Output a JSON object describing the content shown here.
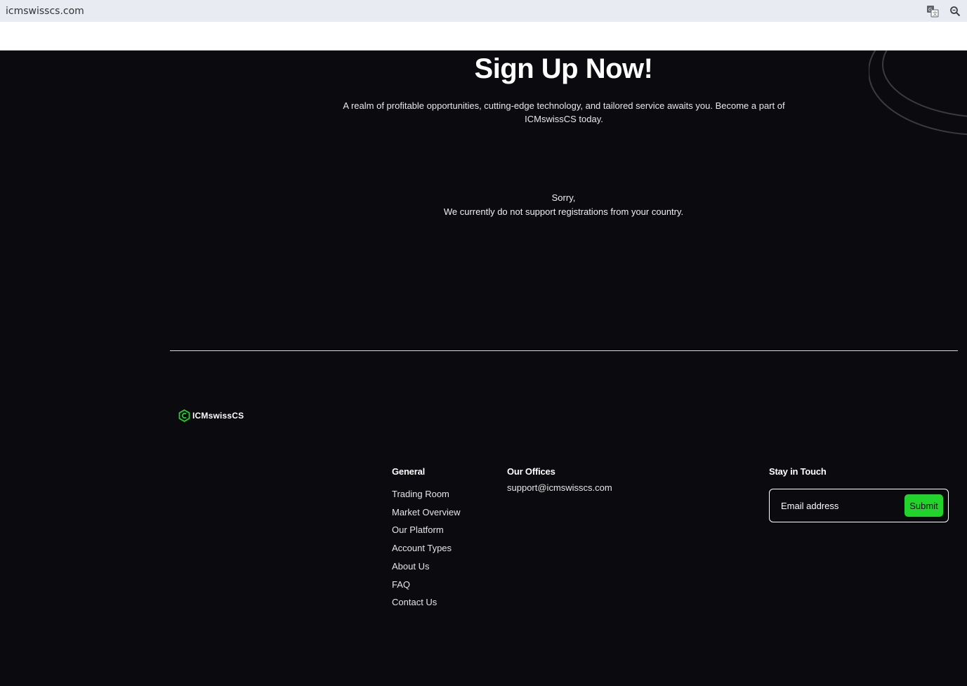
{
  "browser": {
    "url": "icmswisscs.com",
    "icons": [
      "translate-icon",
      "zoom-icon"
    ]
  },
  "hero": {
    "title": "Sign Up Now!",
    "subtitle_line1": "A realm of profitable opportunities, cutting-edge technology, and tailored service awaits you. Become a part of",
    "subtitle_line2": "ICMswissCS today."
  },
  "notice": {
    "line1": "Sorry,",
    "line2": "We currently do not support registrations from your country."
  },
  "footer": {
    "logo_text": "ICMswissCS",
    "general": {
      "heading": "General",
      "links": [
        "Trading Room",
        "Market Overview",
        "Our Platform",
        "Account Types",
        "About Us",
        "FAQ",
        "Contact Us"
      ]
    },
    "offices": {
      "heading": "Our Offices",
      "email": "support@icmswisscs.com"
    },
    "touch": {
      "heading": "Stay in Touch",
      "placeholder": "Email address",
      "submit_label": "Submit"
    }
  },
  "colors": {
    "background": "#0b0b0f",
    "accent": "#22d32b",
    "text": "#ffffff"
  }
}
